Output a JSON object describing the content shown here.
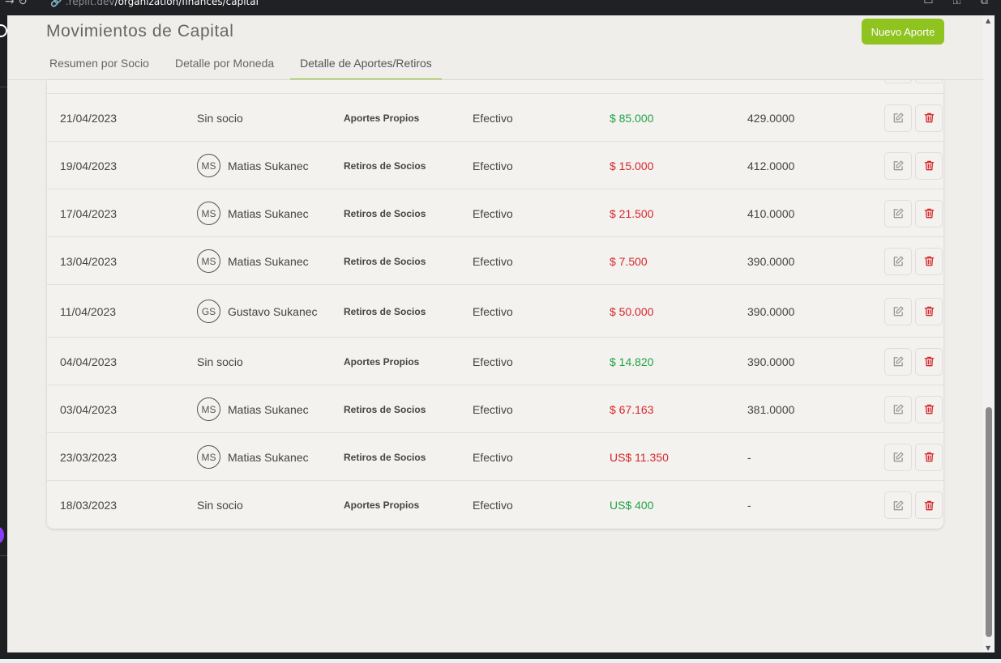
{
  "browser": {
    "nav_icons": "→  ↻",
    "url_host": "🔗 .replit.dev",
    "url_path": "/organization/finances/capital",
    "right_icons": "▭ ⚿ ⧉"
  },
  "header": {
    "title": "Movimientos de Capital",
    "new_button_label": "Nuevo Aporte"
  },
  "tabs": [
    {
      "label": "Resumen por Socio",
      "active": false
    },
    {
      "label": "Detalle por Moneda",
      "active": false
    },
    {
      "label": "Detalle de Aportes/Retiros",
      "active": true
    }
  ],
  "colors": {
    "accent": "#8fc31f",
    "positive": "#21a346",
    "negative": "#d6262b"
  },
  "icons": {
    "edit": "edit-icon",
    "delete": "trash-icon"
  },
  "rows": [
    {
      "date": "21/04/2023",
      "socio_initials": "",
      "socio_name": "Sin socio",
      "concept": "Aportes Propios",
      "medio": "Efectivo",
      "amount": "$ 85.000",
      "type": "positive",
      "rate": "429.0000"
    },
    {
      "date": "19/04/2023",
      "socio_initials": "MS",
      "socio_name": "Matias Sukanec",
      "concept": "Retiros de Socios",
      "medio": "Efectivo",
      "amount": "$ 15.000",
      "type": "negative",
      "rate": "412.0000"
    },
    {
      "date": "17/04/2023",
      "socio_initials": "MS",
      "socio_name": "Matias Sukanec",
      "concept": "Retiros de Socios",
      "medio": "Efectivo",
      "amount": "$ 21.500",
      "type": "negative",
      "rate": "410.0000"
    },
    {
      "date": "13/04/2023",
      "socio_initials": "MS",
      "socio_name": "Matias Sukanec",
      "concept": "Retiros de Socios",
      "medio": "Efectivo",
      "amount": "$ 7.500",
      "type": "negative",
      "rate": "390.0000"
    },
    {
      "date": "11/04/2023",
      "socio_initials": "GS",
      "socio_name": "Gustavo Sukanec",
      "concept": "Retiros de Socios",
      "medio": "Efectivo",
      "amount": "$ 50.000",
      "type": "negative",
      "rate": "390.0000"
    },
    {
      "date": "04/04/2023",
      "socio_initials": "",
      "socio_name": "Sin socio",
      "concept": "Aportes Propios",
      "medio": "Efectivo",
      "amount": "$ 14.820",
      "type": "positive",
      "rate": "390.0000"
    },
    {
      "date": "03/04/2023",
      "socio_initials": "MS",
      "socio_name": "Matias Sukanec",
      "concept": "Retiros de Socios",
      "medio": "Efectivo",
      "amount": "$ 67.163",
      "type": "negative",
      "rate": "381.0000"
    },
    {
      "date": "23/03/2023",
      "socio_initials": "MS",
      "socio_name": "Matias Sukanec",
      "concept": "Retiros de Socios",
      "medio": "Efectivo",
      "amount": "US$ 11.350",
      "type": "negative",
      "rate": "-"
    },
    {
      "date": "18/03/2023",
      "socio_initials": "",
      "socio_name": "Sin socio",
      "concept": "Aportes Propios",
      "medio": "Efectivo",
      "amount": "US$ 400",
      "type": "positive",
      "rate": "-"
    }
  ]
}
